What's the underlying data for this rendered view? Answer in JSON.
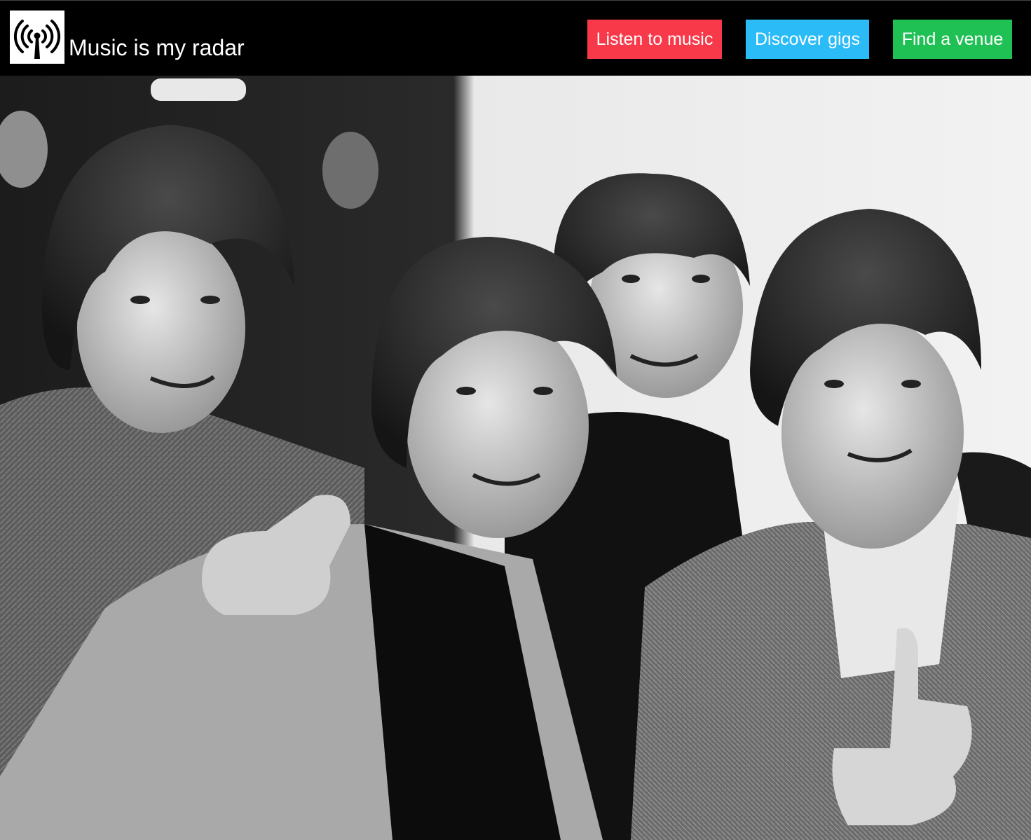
{
  "header": {
    "logo_icon": "radio-antenna-icon",
    "title": "Music is my radar"
  },
  "nav": {
    "listen": {
      "label": "Listen to music",
      "color": "#f7394a"
    },
    "gigs": {
      "label": "Discover gigs",
      "color": "#2bbcf8"
    },
    "venue": {
      "label": "Find a venue",
      "color": "#1fc154"
    }
  },
  "hero": {
    "image": "black-and-white-band-photo"
  }
}
